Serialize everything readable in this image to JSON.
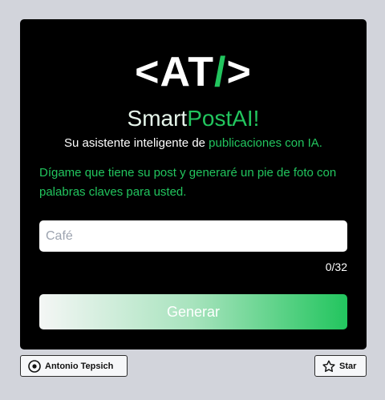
{
  "logo": {
    "lt": "<",
    "at": "AT",
    "slash": "/",
    "gt": ">"
  },
  "brand": {
    "part1": "Smart",
    "part2": "PostAI!"
  },
  "tagline": {
    "part1": "Su asistente inteligente de ",
    "part2": "publicaciones con IA."
  },
  "description": "Dígame que tiene su post y generaré un pie de foto con palabras claves para usted.",
  "input": {
    "value": "",
    "placeholder": "Café"
  },
  "counter": "0/32",
  "generate_label": "Generar",
  "footer": {
    "author_label": "Antonio Tepsich",
    "author_icon": "github-mark-icon",
    "star_label": "Star",
    "star_icon": "star-icon"
  },
  "colors": {
    "accent": "#22c55e",
    "card_background": "#000000",
    "page_background": "#d2d4db"
  }
}
